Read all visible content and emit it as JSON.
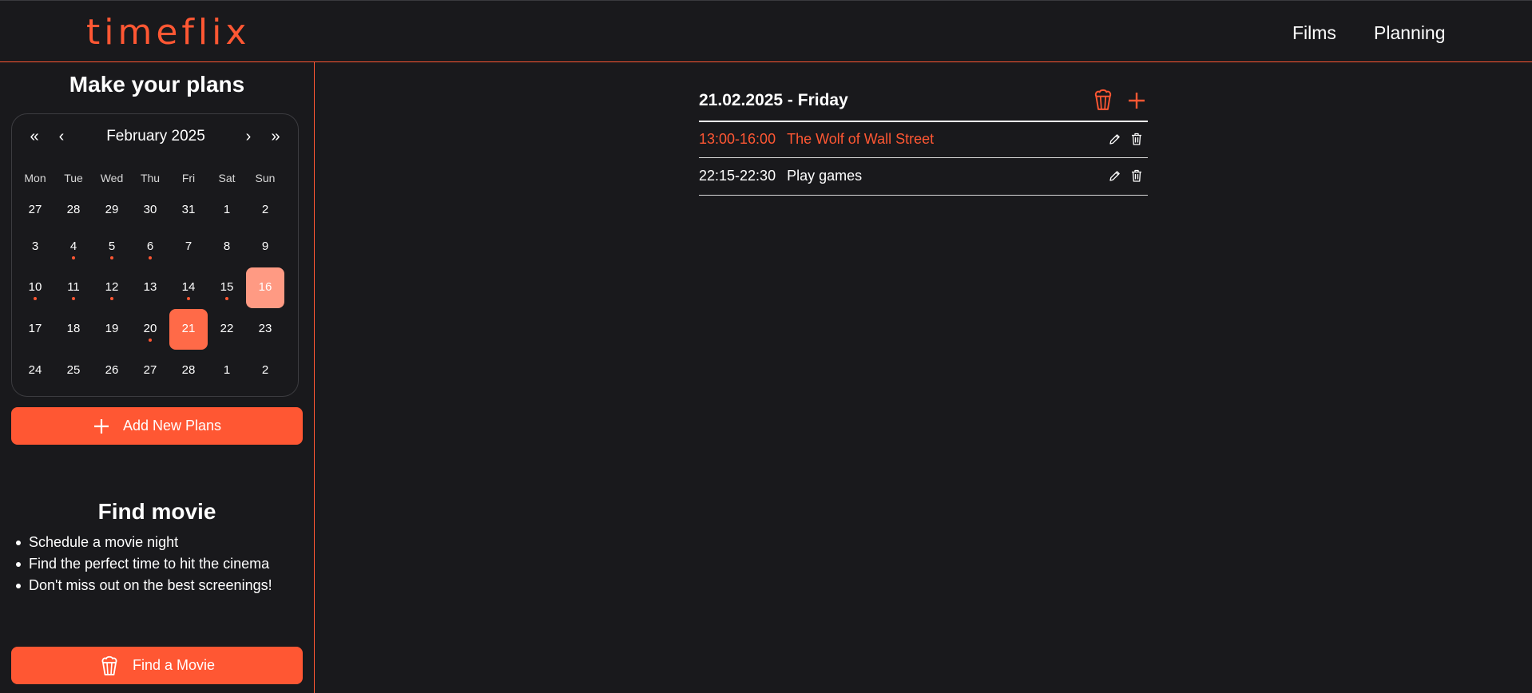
{
  "header": {
    "logo": "timeflix",
    "nav": [
      "Films",
      "Planning"
    ]
  },
  "sidebar": {
    "plans_title": "Make your plans",
    "calendar": {
      "month_label": "February 2025",
      "prev_year": "«",
      "prev_month": "‹",
      "next_month": "›",
      "next_year": "»",
      "weekdays": [
        "Mon",
        "Tue",
        "Wed",
        "Thu",
        "Fri",
        "Sat",
        "Sun"
      ],
      "weeks": [
        [
          "27",
          "28",
          "29",
          "30",
          "31",
          "1",
          "2"
        ],
        [
          "3",
          "4",
          "5",
          "6",
          "7",
          "8",
          "9"
        ],
        [
          "10",
          "11",
          "12",
          "13",
          "14",
          "15",
          "16"
        ],
        [
          "17",
          "18",
          "19",
          "20",
          "21",
          "22",
          "23"
        ],
        [
          "24",
          "25",
          "26",
          "27",
          "28",
          "1",
          "2"
        ]
      ],
      "days_with_plans": [
        "4",
        "5",
        "6",
        "10",
        "11",
        "12",
        "14",
        "15",
        "20"
      ],
      "today": "16",
      "selected": "21"
    },
    "add_plans_label": "Add New Plans",
    "find_title": "Find movie",
    "features": [
      "Schedule a movie night",
      "Find the perfect time to hit the cinema",
      "Don't miss out on the best screenings!"
    ],
    "find_movie_label": "Find a Movie"
  },
  "planner": {
    "date_heading": "21.02.2025 - Friday",
    "plans": [
      {
        "time": "13:00-16:00",
        "title": "The Wolf of Wall Street",
        "is_movie": true
      },
      {
        "time": "22:15-22:30",
        "title": "Play games",
        "is_movie": false
      }
    ]
  },
  "colors": {
    "accent": "#ff5733",
    "background": "#19191c",
    "today_bg": "#ff9a83",
    "selected_bg": "#ff6a48"
  }
}
